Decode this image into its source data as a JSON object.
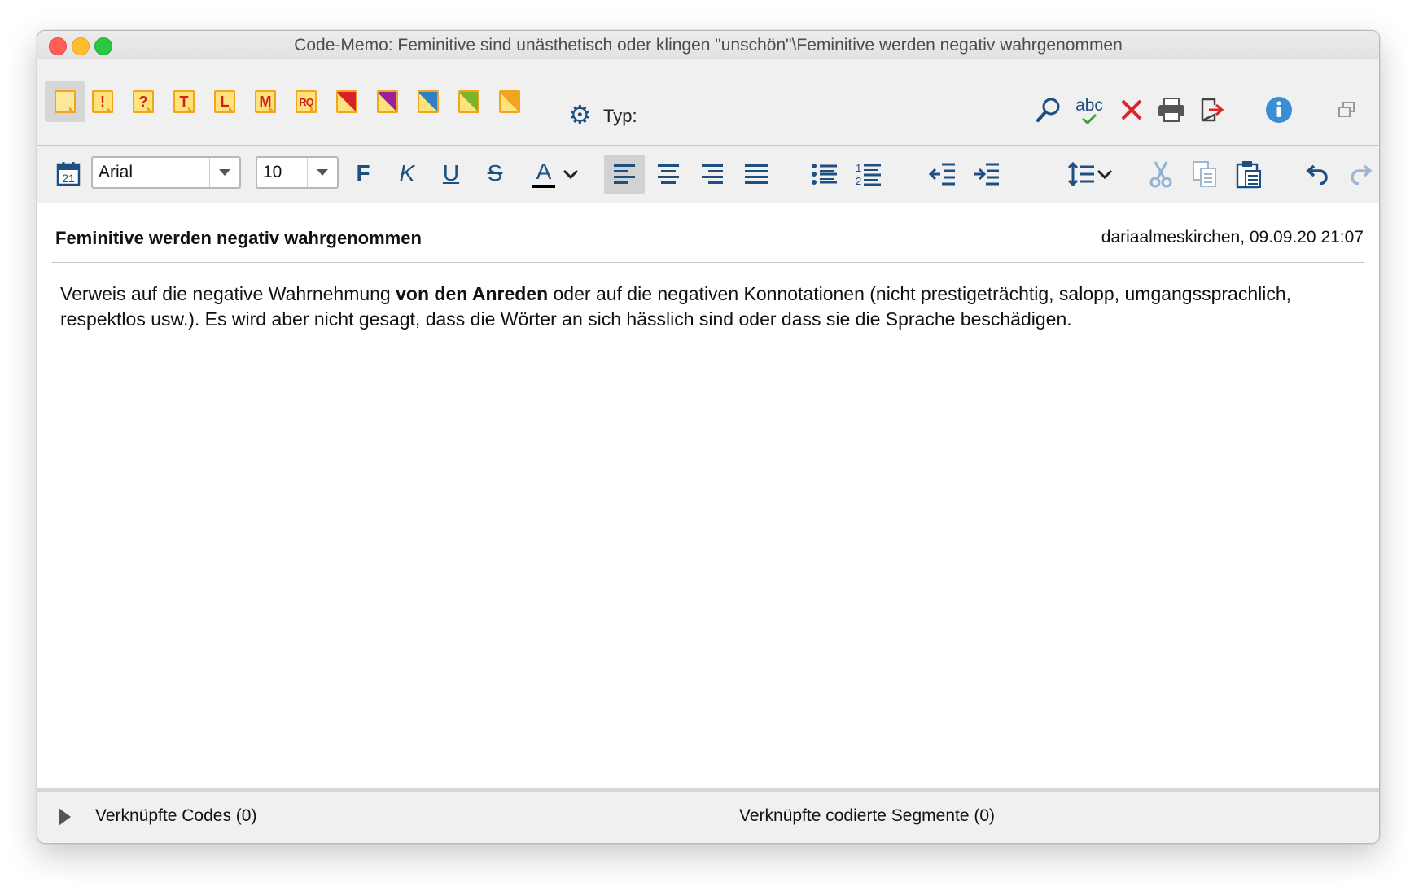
{
  "window": {
    "title": "Code-Memo: Feminitive sind unästhetisch oder klingen \"unschön\"\\Feminitive werden negativ wahrgenommen"
  },
  "memo_types": [
    {
      "label": ""
    },
    {
      "label": "!"
    },
    {
      "label": "?"
    },
    {
      "label": "T"
    },
    {
      "label": "L"
    },
    {
      "label": "M"
    },
    {
      "label": "RQ"
    }
  ],
  "memo_colors": [
    "#d8222a",
    "#9b1f9c",
    "#2f7fc6",
    "#7ab628",
    "#f0a41f"
  ],
  "toolbar": {
    "typ_label": "Typ:"
  },
  "format": {
    "date_icon_text": "21",
    "font_family": "Arial",
    "font_size": "10",
    "bold": "F",
    "italic": "K",
    "underline": "U",
    "strike": "S",
    "color": "A",
    "spell": "abc"
  },
  "memo": {
    "title": "Feminitive werden negativ wahrgenommen",
    "meta": "dariaalmeskirchen, 09.09.20 21:07",
    "body_part1": "Verweis auf die negative Wahrnehmung ",
    "body_bold": "von den Anreden",
    "body_part2": " oder auf die negativen Konnotationen (nicht prestigeträchtig, salopp, umgangssprachlich, respektlos usw.). Es wird aber nicht gesagt, dass die Wörter an sich hässlich sind oder dass sie die Sprache beschädigen."
  },
  "footer": {
    "linked_codes": "Verknüpfte Codes (0)",
    "linked_segments": "Verknüpfte codierte Segmente (0)"
  }
}
